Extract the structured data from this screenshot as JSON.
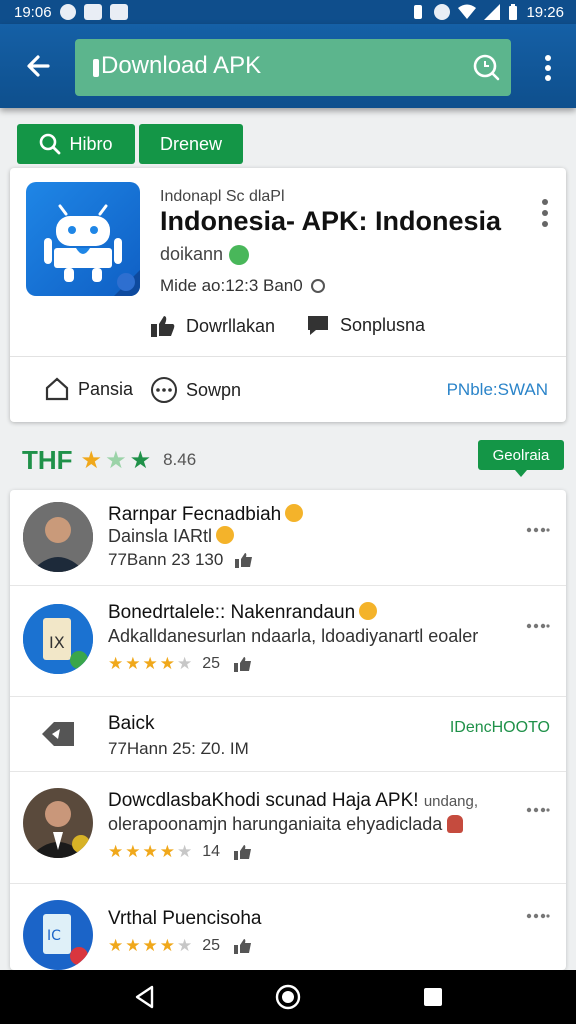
{
  "status_bar": {
    "time_left": "19:06",
    "time_right": "19:26"
  },
  "search": {
    "value": "Download APK"
  },
  "chips": [
    {
      "label": "Hibro"
    },
    {
      "label": "Drenew"
    }
  ],
  "app_card": {
    "subtitle": "Indonapl Sc dlaPl",
    "title": "Indonesia- APK: Indonesia",
    "developer": "doikann",
    "meta": "Mide ao:12:3 Ban0",
    "actions": [
      {
        "label": "Dowrllakan"
      },
      {
        "label": "Sonplusna"
      }
    ],
    "bottom": [
      {
        "label": "Pansia"
      },
      {
        "label": "Sowpn"
      }
    ],
    "link": "PNble:SWAN"
  },
  "rating": {
    "label": "THF",
    "count": "8.46",
    "button": "Geolraia",
    "stars": [
      {
        "state": "on"
      },
      {
        "state": "half"
      },
      {
        "state": "on-green"
      }
    ]
  },
  "reviews": [
    {
      "name": "Rarnpar Fecnadbiah",
      "line": "Dainsla IARtl",
      "meta": "77Bann 23 130"
    },
    {
      "name": "Bonedrtalele:: Nakenrandaun",
      "line": "Adkalldanesurlan ndaarla, ldoadiyanartl eoaler",
      "stars": 4,
      "count": "25"
    },
    {
      "name": "Baick",
      "line": "77Hann 25: Z0. IM",
      "link": "IDencHOOTO"
    },
    {
      "name": "DowcdlasbaKhodi scunad  Haja APK!",
      "name_suffix": "undang,",
      "line": "olerapoonamjn harunganiaita ehyadiclada",
      "stars": 4,
      "count": "14"
    },
    {
      "name": "Vrthal Puencisoha",
      "stars": 4,
      "count": "25"
    }
  ],
  "colors": {
    "app_bar": "#1560a6",
    "search_bg": "#5cb58d",
    "accent_green": "#149647",
    "star": "#f0a81b",
    "link_blue": "#2b84c9"
  }
}
